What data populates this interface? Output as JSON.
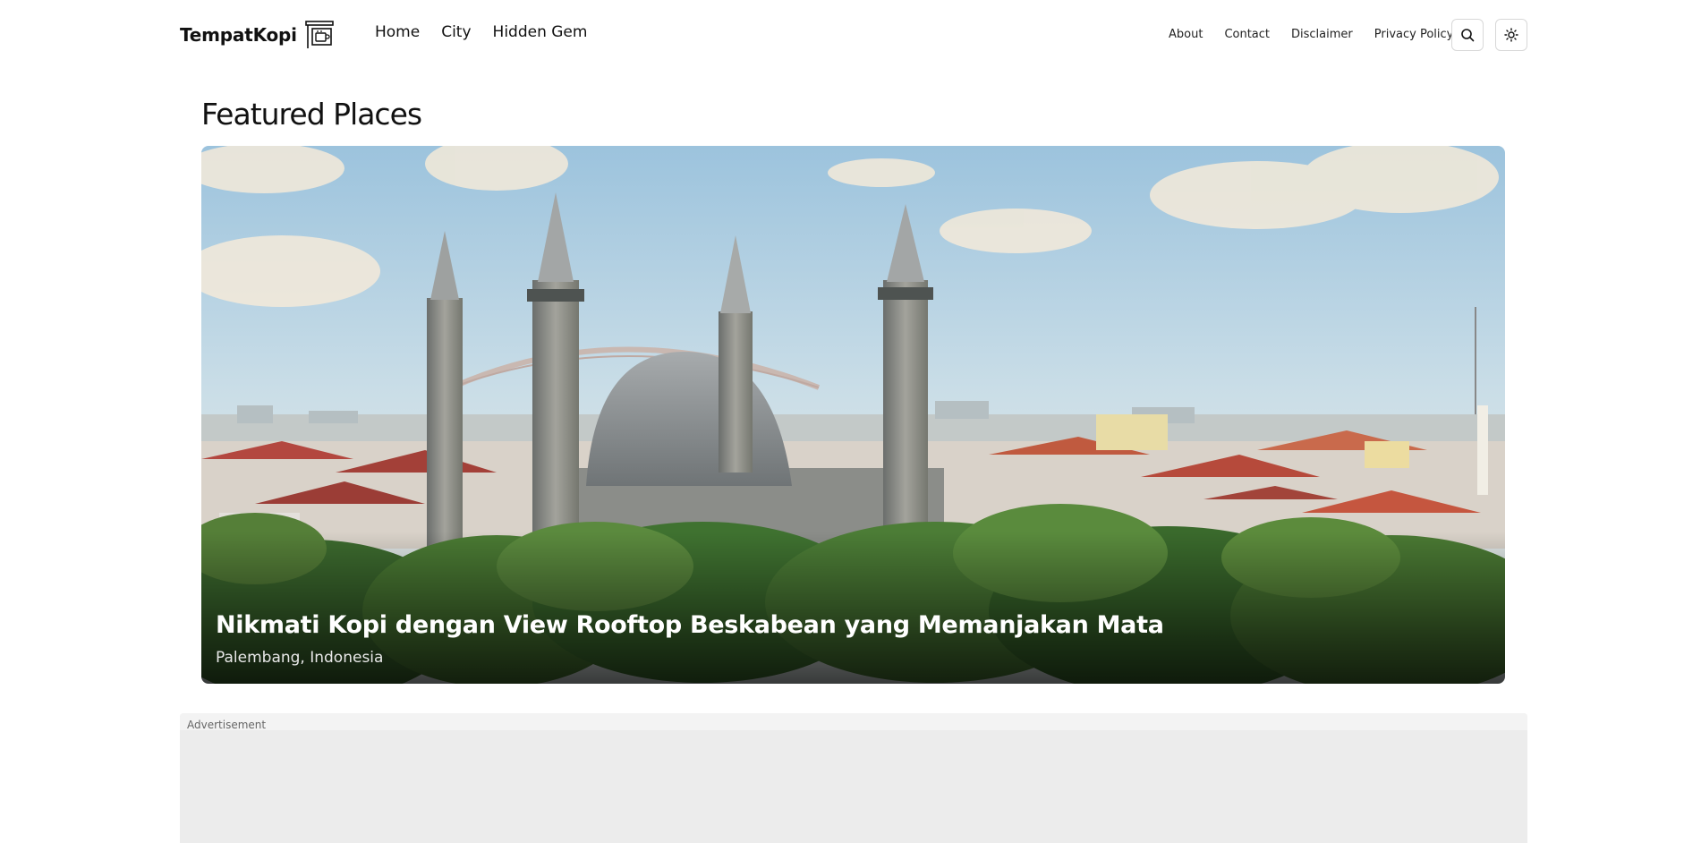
{
  "header": {
    "brand": "TempatKopi",
    "main_nav": [
      "Home",
      "City",
      "Hidden Gem"
    ],
    "secondary_nav": [
      "About",
      "Contact",
      "Disclaimer",
      "Privacy Policy"
    ]
  },
  "featured": {
    "heading": "Featured Places",
    "card": {
      "title": "Nikmati Kopi dengan View Rooftop Beskabean yang Memanjakan Mata",
      "location": "Palembang, Indonesia"
    }
  },
  "advertisement": {
    "label": "Advertisement"
  }
}
